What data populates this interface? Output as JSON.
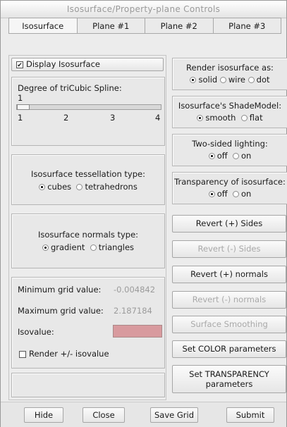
{
  "window": {
    "title": "Isosurface/Property-plane Controls"
  },
  "tabs": [
    "Isosurface",
    "Plane #1",
    "Plane #2",
    "Plane #3"
  ],
  "left": {
    "display_iso_label": "Display Isosurface",
    "spline": {
      "label": "Degree of triCubic Spline:",
      "value": "1",
      "slider_fraction": 0,
      "ticks": [
        "1",
        "2",
        "3",
        "4"
      ]
    },
    "tessellation": {
      "label": "Isosurface tessellation type:",
      "options": [
        "cubes",
        "tetrahedrons"
      ],
      "selected": "cubes"
    },
    "normals": {
      "label": "Isosurface normals type:",
      "options": [
        "gradient",
        "triangles"
      ],
      "selected": "gradient"
    },
    "grid": {
      "min_label": "Minimum grid value:",
      "min_value": "-0.004842",
      "max_label": "Maximum grid value:",
      "max_value": "2.187184",
      "isovalue_label": "Isovalue:",
      "isovalue": "",
      "render_pm_label": "Render +/- isovalue"
    }
  },
  "right": {
    "render_as": {
      "label": "Render isosurface as:",
      "options": [
        "solid",
        "wire",
        "dot"
      ],
      "selected": "solid"
    },
    "shade_model": {
      "label": "Isosurface's ShadeModel:",
      "options": [
        "smooth",
        "flat"
      ],
      "selected": "smooth"
    },
    "two_sided": {
      "label": "Two-sided lighting:",
      "options": [
        "off",
        "on"
      ],
      "selected": "off"
    },
    "transparency": {
      "label": "Transparency of isosurface:",
      "options": [
        "off",
        "on"
      ],
      "selected": "off"
    },
    "buttons": {
      "revert_plus_sides": "Revert (+) Sides",
      "revert_minus_sides": "Revert (-) Sides",
      "revert_plus_normals": "Revert (+) normals",
      "revert_minus_normals": "Revert (-) normals",
      "surface_smoothing": "Surface Smoothing",
      "set_color": "Set COLOR parameters",
      "set_transparency": "Set TRANSPARENCY parameters"
    }
  },
  "footer": {
    "hide": "Hide",
    "close": "Close",
    "save_grid": "Save Grid",
    "submit": "Submit"
  },
  "colors": {
    "isovalue_field": "#d89a9e",
    "disabled_text": "#a9a9a9"
  }
}
